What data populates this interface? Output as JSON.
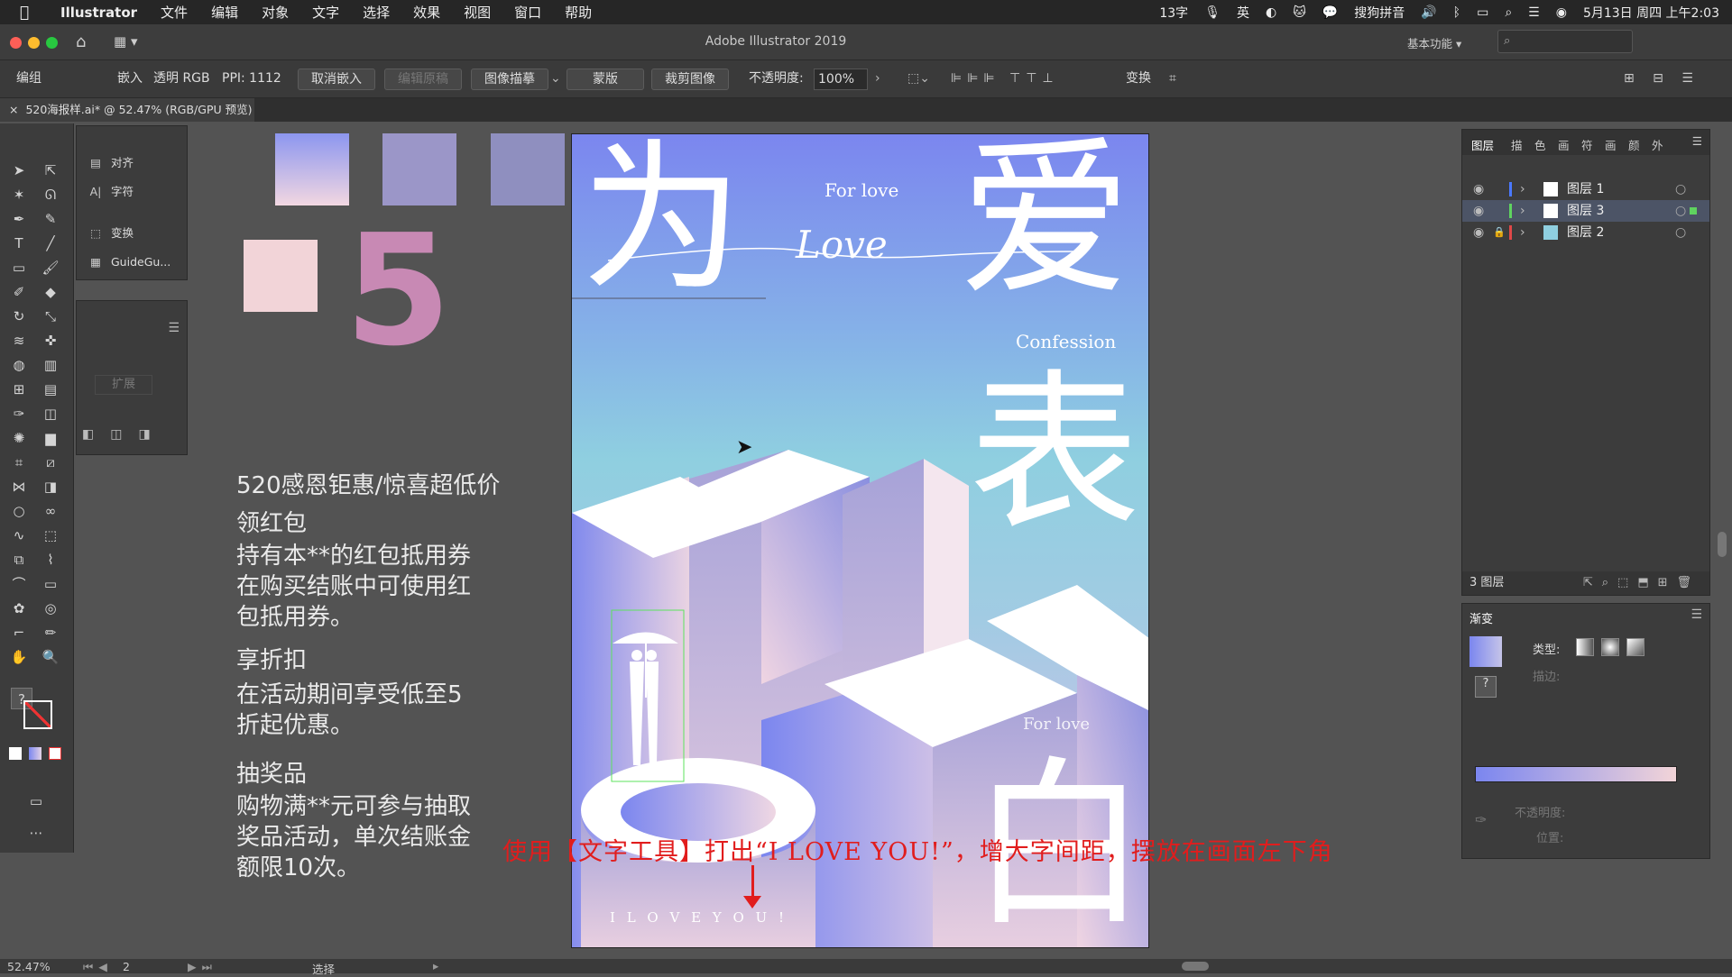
{
  "menubar": {
    "app": "Illustrator",
    "items": [
      "文件",
      "编辑",
      "对象",
      "文字",
      "选择",
      "效果",
      "视图",
      "窗口",
      "帮助"
    ],
    "status_count": "13字",
    "ime": "英",
    "sogou": "搜狗拼音",
    "datetime": "5月13日 周四 上午2:03"
  },
  "window": {
    "title": "Adobe Illustrator 2019",
    "workspace": "基本功能"
  },
  "controlbar": {
    "group": "编组",
    "embed": "嵌入",
    "color_mode": "透明 RGB",
    "ppi": "PPI: 1112",
    "unembed": "取消嵌入",
    "edit_original": "编辑原稿",
    "image_trace": "图像描摹",
    "mask": "蒙版",
    "crop": "裁剪图像",
    "opacity_label": "不透明度:",
    "opacity_value": "100%",
    "transform": "变换"
  },
  "document_tab": "520海报样.ai* @ 52.47% (RGB/GPU 预览)",
  "flyout": {
    "items": [
      "对齐",
      "字符",
      "变换",
      "GuideGu..."
    ],
    "expand": "扩展"
  },
  "swatch_number": "5",
  "notes": {
    "title": "520感恩钜惠/惊喜超低价",
    "h1": "领红包",
    "p1": [
      "持有本**的红包抵用券",
      "在购买结账中可使用红",
      "包抵用券。"
    ],
    "h2": "享折扣",
    "p2": [
      "在活动期间享受低至5",
      "折起优惠。"
    ],
    "h3": "抽奖品",
    "p3": [
      "购物满**元可参与抽取",
      "奖品活动，单次结账金",
      "额限10次。"
    ]
  },
  "poster": {
    "chars": [
      "为",
      "爱",
      "表",
      "白"
    ],
    "for_love": "For love",
    "script": "Love",
    "confession": "Confession",
    "for_love2": "For love",
    "i_love_you": "I  L  O  V  E   Y  O  U  !"
  },
  "annotation": "使用【文字工具】打出“I LOVE YOU!”，增大字间距，摆放在画面左下角",
  "layers_panel": {
    "tabs": [
      "图层",
      "描",
      "色",
      "画",
      "符",
      "画",
      "颜",
      "外"
    ],
    "layers": [
      {
        "name": "图层 1",
        "color": "#4a78ff"
      },
      {
        "name": "图层 3",
        "color": "#5fd35f"
      },
      {
        "name": "图层 2",
        "color": "#e04848"
      }
    ],
    "count": "3 图层"
  },
  "gradient_panel": {
    "title": "渐变",
    "type_label": "类型:",
    "stroke_label": "描边:",
    "opacity_label": "不透明度:",
    "position_label": "位置:"
  },
  "statusbar": {
    "zoom": "52.47%",
    "page": "2",
    "tool": "选择"
  },
  "colors": {
    "accent_blue": "#7b86ef",
    "accent_pink": "#c889b4",
    "annotation_red": "#e11d1d"
  }
}
